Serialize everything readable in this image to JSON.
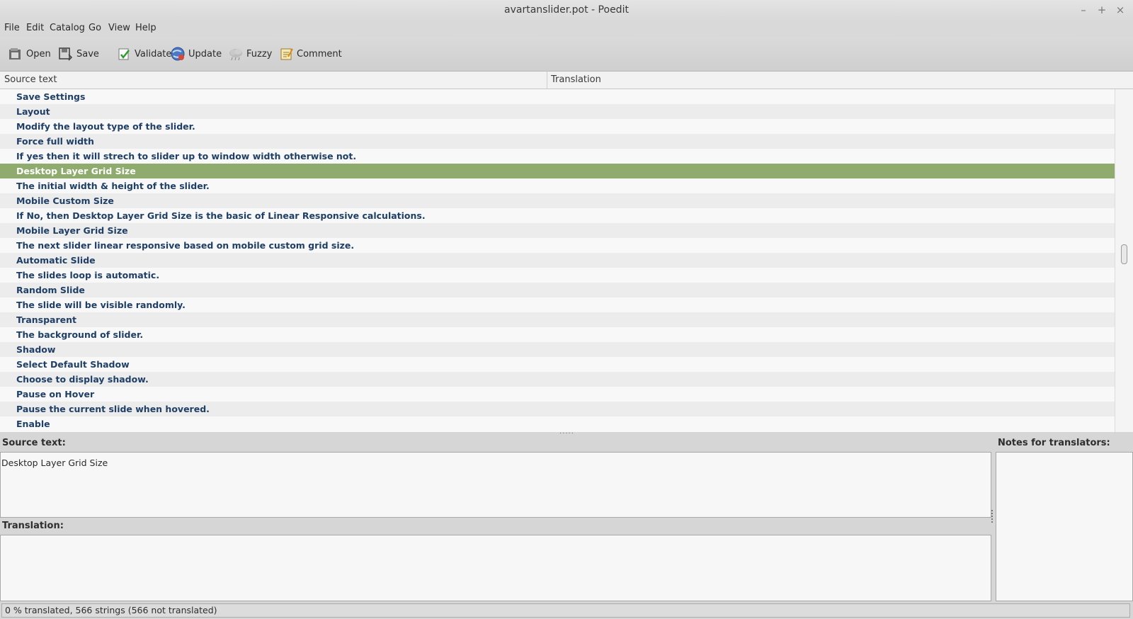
{
  "window": {
    "title": "avartanslider.pot - Poedit",
    "controls": [
      "–",
      "+",
      "×"
    ]
  },
  "menu": [
    "File",
    "Edit",
    "Catalog",
    "Go",
    "View",
    "Help"
  ],
  "toolbar": {
    "open": "Open",
    "save": "Save",
    "validate": "Validate",
    "update": "Update",
    "fuzzy": "Fuzzy",
    "comment": "Comment"
  },
  "list": {
    "columns": [
      "Source text",
      "Translation"
    ],
    "selected_index": 5,
    "rows": [
      {
        "source": "Save Settings",
        "translation": ""
      },
      {
        "source": "Layout",
        "translation": ""
      },
      {
        "source": "Modify the layout type of the slider.",
        "translation": ""
      },
      {
        "source": "Force full width",
        "translation": ""
      },
      {
        "source": "If yes then it will strech to slider up to window width otherwise not.",
        "translation": ""
      },
      {
        "source": "Desktop Layer Grid Size",
        "translation": ""
      },
      {
        "source": "The initial width & height of the slider.",
        "translation": ""
      },
      {
        "source": "Mobile Custom Size",
        "translation": ""
      },
      {
        "source": "If No, then Desktop Layer Grid Size is the basic of Linear Responsive calculations.",
        "translation": ""
      },
      {
        "source": "Mobile Layer Grid Size",
        "translation": ""
      },
      {
        "source": "The next slider linear responsive based on mobile custom grid size.",
        "translation": ""
      },
      {
        "source": "Automatic Slide",
        "translation": ""
      },
      {
        "source": "The slides loop is automatic.",
        "translation": ""
      },
      {
        "source": "Random Slide",
        "translation": ""
      },
      {
        "source": "The slide will be visible randomly.",
        "translation": ""
      },
      {
        "source": "Transparent",
        "translation": ""
      },
      {
        "source": "The background of slider.",
        "translation": ""
      },
      {
        "source": "Shadow",
        "translation": ""
      },
      {
        "source": "Select Default Shadow",
        "translation": ""
      },
      {
        "source": "Choose to display shadow.",
        "translation": ""
      },
      {
        "source": "Pause on Hover",
        "translation": ""
      },
      {
        "source": "Pause the current slide when hovered.",
        "translation": ""
      },
      {
        "source": "Enable",
        "translation": ""
      }
    ]
  },
  "editor": {
    "source_label": "Source text:",
    "source_value": "Desktop Layer Grid Size",
    "translation_label": "Translation:",
    "translation_value": "",
    "notes_label": "Notes for translators:",
    "notes_value": ""
  },
  "status": {
    "text": "0 % translated, 566 strings (566 not translated)"
  },
  "colors": {
    "selection": "#8fac6e",
    "source_text": "#1f3f66"
  }
}
